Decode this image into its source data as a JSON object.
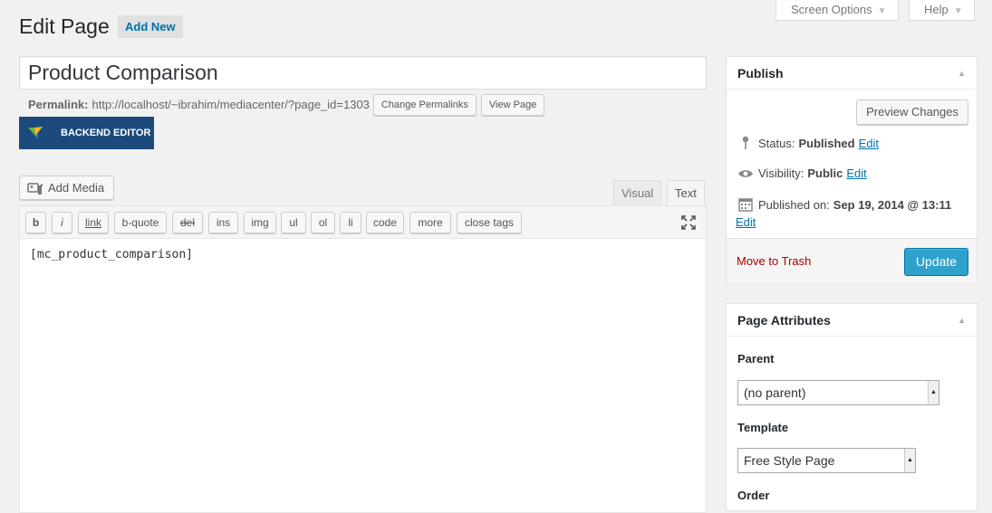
{
  "screen_meta": {
    "screen_options": "Screen Options",
    "help": "Help"
  },
  "header": {
    "title": "Edit Page",
    "add_new": "Add New"
  },
  "post": {
    "title": "Product Comparison",
    "permalink_label": "Permalink:",
    "permalink_url": "http://localhost/~ibrahim/mediacenter/?page_id=1303",
    "change_permalinks": "Change Permalinks",
    "view_page": "View Page",
    "backend_editor": "BACKEND EDITOR"
  },
  "editor": {
    "add_media": "Add Media",
    "tabs": {
      "visual": "Visual",
      "text": "Text"
    },
    "quicktags": [
      "b",
      "i",
      "link",
      "b-quote",
      "del",
      "ins",
      "img",
      "ul",
      "ol",
      "li",
      "code",
      "more",
      "close tags"
    ],
    "content": "[mc_product_comparison]"
  },
  "publish": {
    "title": "Publish",
    "preview_changes": "Preview Changes",
    "status_label": "Status:",
    "status_value": "Published",
    "visibility_label": "Visibility:",
    "visibility_value": "Public",
    "published_label": "Published on:",
    "published_value": "Sep 19, 2014 @ 13:11",
    "edit": "Edit",
    "move_to_trash": "Move to Trash",
    "update": "Update"
  },
  "attributes": {
    "title": "Page Attributes",
    "parent_label": "Parent",
    "parent_value": "(no parent)",
    "template_label": "Template",
    "template_value": "Free Style Page",
    "order_label": "Order"
  },
  "colors": {
    "accent_link": "#0073aa",
    "update_button": "#2ea2cc",
    "backend_editor_bg": "#1c4a7c",
    "trash": "#aa0000"
  }
}
